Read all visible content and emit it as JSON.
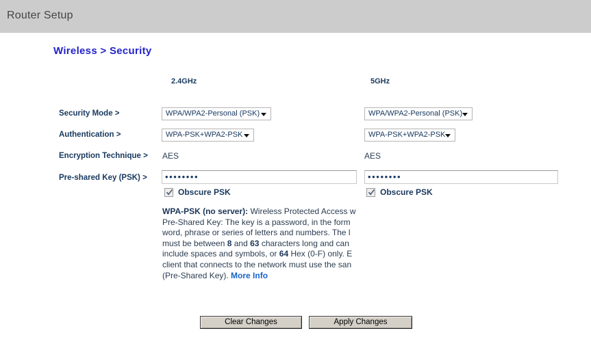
{
  "window": {
    "title": "Router Setup"
  },
  "page": {
    "heading": "Wireless > Security"
  },
  "columns": {
    "band_24": "2.4GHz",
    "band_5": "5GHz"
  },
  "labels": {
    "security_mode": "Security Mode >",
    "authentication": "Authentication >",
    "encryption_technique": "Encryption Technique >",
    "pre_shared_key": "Pre-shared Key (PSK) >"
  },
  "band_24": {
    "security_mode": "WPA/WPA2-Personal (PSK)",
    "authentication": "WPA-PSK+WPA2-PSK",
    "encryption_technique": "AES",
    "psk_value": "••••••••",
    "obscure_psk_label": "Obscure PSK",
    "obscure_psk_checked": true
  },
  "band_5": {
    "security_mode": "WPA/WPA2-Personal (PSK)",
    "authentication": "WPA-PSK+WPA2-PSK",
    "encryption_technique": "AES",
    "psk_value": "••••••••",
    "obscure_psk_label": "Obscure PSK",
    "obscure_psk_checked": true
  },
  "description": {
    "line1_bold": "WPA-PSK (no server):",
    "line1_rest": " Wireless Protected Access w",
    "line2": "Pre-Shared Key: The key is a password, in the form",
    "line3": "word, phrase or series of letters and numbers. The l",
    "line4_a": "must be between ",
    "line4_b1": "8",
    "line4_b": " and ",
    "line4_b2": "63",
    "line4_c": " characters long and can",
    "line5_a": "include spaces and symbols, or ",
    "line5_b": "64",
    "line5_c": " Hex (0-F) only. E",
    "line6": "client that connects to the network must use the san",
    "line7": "(Pre-Shared Key).",
    "more_info": "More Info"
  },
  "buttons": {
    "clear": "Clear Changes",
    "apply": "Apply Changes"
  },
  "colors": {
    "titlebar_bg": "#cccccc",
    "heading_blue": "#2222cc",
    "label_navy": "#18385e",
    "link_blue": "#1563c8",
    "button_face": "#d4d0c8"
  }
}
